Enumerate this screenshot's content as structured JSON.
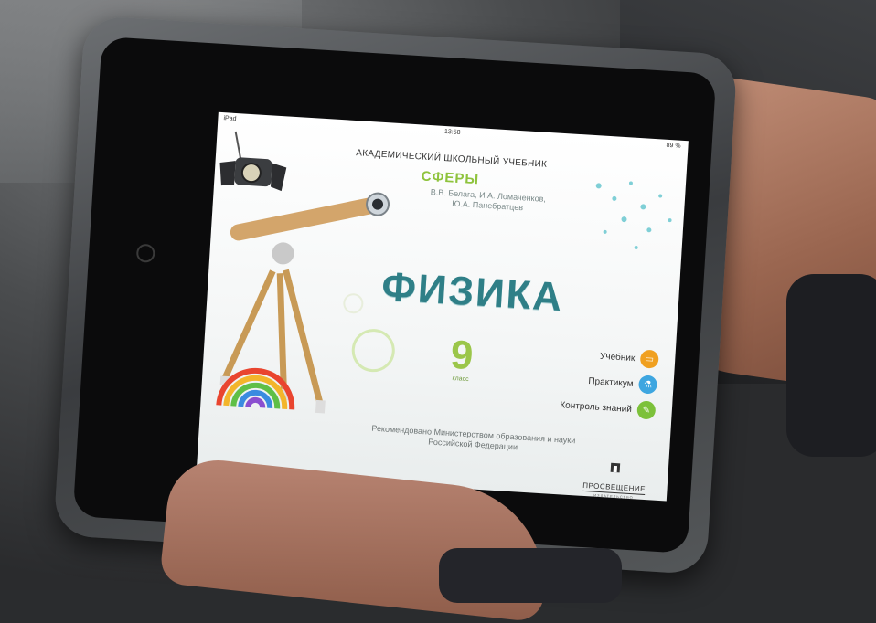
{
  "status_bar": {
    "device": "iPad",
    "time": "13:58",
    "battery": "89 %"
  },
  "book": {
    "series_title": "АКАДЕМИЧЕСКИЙ ШКОЛЬНЫЙ УЧЕБНИК",
    "series_name": "СФЕРЫ",
    "authors": [
      "В.В. Белага, И.А. Ломаченков,",
      "Ю.А. Панебратцев"
    ],
    "subject": "ФИЗИКА",
    "grade_number": "9",
    "grade_label": "класс"
  },
  "menu": {
    "items": [
      {
        "label": "Учебник",
        "icon": "book-icon",
        "color": "#f0a020",
        "glyph": "▭"
      },
      {
        "label": "Практикум",
        "icon": "beaker-icon",
        "color": "#3ea6e0",
        "glyph": "⚗"
      },
      {
        "label": "Контроль знаний",
        "icon": "pencil-icon",
        "color": "#7cc13a",
        "glyph": "✎"
      }
    ]
  },
  "footer": {
    "recommendation": [
      "Рекомендовано Министерством образования и науки",
      "Российской Федерации"
    ],
    "publisher": "ПРОСВЕЩЕНИЕ",
    "publisher_sub": "ИЗДАТЕЛЬСТВО"
  }
}
